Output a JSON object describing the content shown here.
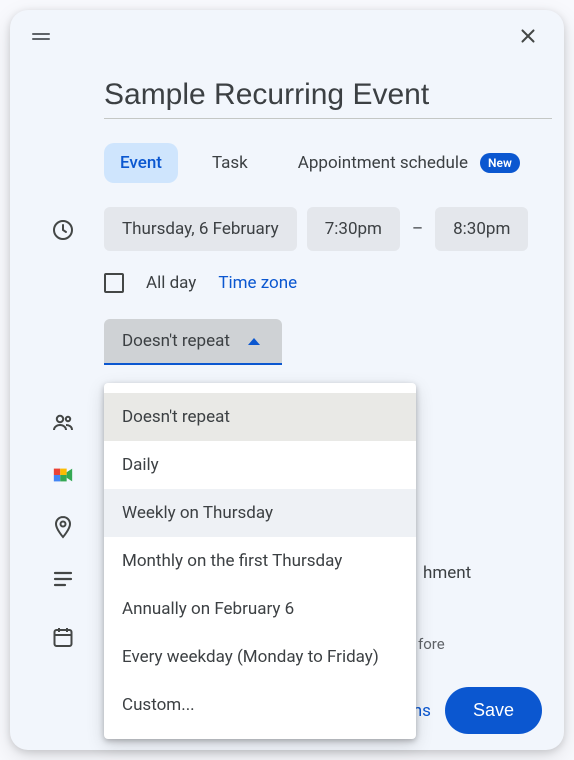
{
  "title": "Sample Recurring Event",
  "tabs": {
    "event": "Event",
    "task": "Task",
    "appointment": "Appointment schedule",
    "new_badge": "New"
  },
  "date_chip": "Thursday, 6 February",
  "start_time": "7:30pm",
  "end_time": "8:30pm",
  "time_separator": "–",
  "all_day_label": "All day",
  "time_zone_label": "Time zone",
  "repeat_selected": "Doesn't repeat",
  "repeat_options": [
    "Doesn't repeat",
    "Daily",
    "Weekly on Thursday",
    "Monthly on the first Thursday",
    "Annually on February 6",
    "Every weekday (Monday to Friday)",
    "Custom..."
  ],
  "ghost_attachment_suffix": "hment",
  "ghost_notification_suffix": "fore",
  "more_options_suffix": "ns",
  "save_label": "Save"
}
